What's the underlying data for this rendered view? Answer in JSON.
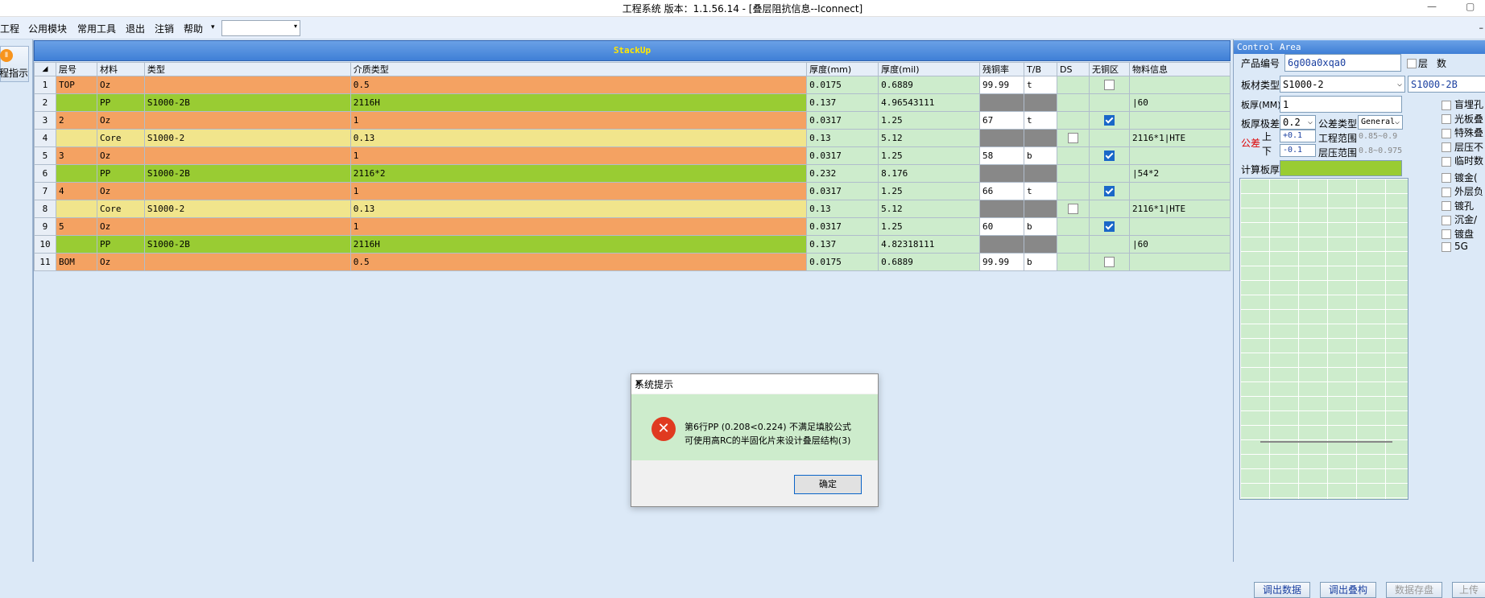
{
  "window": {
    "title": "工程系统   版本：1.1.56.14 - [叠层阻抗信息--Iconnect]",
    "min": "—",
    "restore": "▢"
  },
  "menu": {
    "items": [
      "工程",
      "公用模块",
      "常用工具",
      "退出",
      "注销",
      "帮助"
    ],
    "dropdown_arrow": "▾",
    "combo_value": "",
    "right_mark": "–"
  },
  "left": {
    "button_label": "程指示"
  },
  "stackup": {
    "title": "StackUp",
    "columns": [
      "",
      "层号",
      "材料",
      "类型",
      "介质类型",
      "厚度(mm)",
      "厚度(mil)",
      "残铜率",
      "T/B",
      "DS",
      "无铜区",
      "物料信息"
    ],
    "rows": [
      {
        "idx": "1",
        "kind": "oz",
        "layer": "TOP",
        "material": "Oz",
        "type": "",
        "dielectric": "0.5",
        "mm": "0.0175",
        "mil": "0.6889",
        "residual": "99.99",
        "tb": "t",
        "ds": "",
        "nocu": "unchecked",
        "info": ""
      },
      {
        "idx": "2",
        "kind": "pp",
        "layer": "",
        "material": "PP",
        "type": "S1000-2B",
        "dielectric": "2116H",
        "mm": "0.137",
        "mil": "4.96543111",
        "residual": "gray",
        "tb": "gray",
        "ds": "",
        "nocu": "",
        "info": "|60"
      },
      {
        "idx": "3",
        "kind": "oz",
        "layer": "2",
        "material": "Oz",
        "type": "",
        "dielectric": "1",
        "mm": "0.0317",
        "mil": "1.25",
        "residual": "67",
        "tb": "t",
        "ds": "",
        "nocu": "checked",
        "info": ""
      },
      {
        "idx": "4",
        "kind": "core",
        "layer": "",
        "material": "Core",
        "type": "S1000-2",
        "dielectric": "0.13",
        "mm": "0.13",
        "mil": "5.12",
        "residual": "gray",
        "tb": "gray",
        "ds": "unchecked",
        "nocu": "",
        "info": "2116*1|HTE"
      },
      {
        "idx": "5",
        "kind": "oz",
        "layer": "3",
        "material": "Oz",
        "type": "",
        "dielectric": "1",
        "mm": "0.0317",
        "mil": "1.25",
        "residual": "58",
        "tb": "b",
        "ds": "",
        "nocu": "checked",
        "info": ""
      },
      {
        "idx": "6",
        "kind": "pp",
        "layer": "",
        "material": "PP",
        "type": "S1000-2B",
        "dielectric": "2116*2",
        "mm": "0.232",
        "mil": "8.176",
        "residual": "gray",
        "tb": "gray",
        "ds": "",
        "nocu": "",
        "info": "|54*2"
      },
      {
        "idx": "7",
        "kind": "oz",
        "layer": "4",
        "material": "Oz",
        "type": "",
        "dielectric": "1",
        "mm": "0.0317",
        "mil": "1.25",
        "residual": "66",
        "tb": "t",
        "ds": "",
        "nocu": "checked",
        "info": ""
      },
      {
        "idx": "8",
        "kind": "core",
        "layer": "",
        "material": "Core",
        "type": "S1000-2",
        "dielectric": "0.13",
        "mm": "0.13",
        "mil": "5.12",
        "residual": "gray",
        "tb": "gray",
        "ds": "unchecked",
        "nocu": "",
        "info": "2116*1|HTE"
      },
      {
        "idx": "9",
        "kind": "oz",
        "layer": "5",
        "material": "Oz",
        "type": "",
        "dielectric": "1",
        "mm": "0.0317",
        "mil": "1.25",
        "residual": "60",
        "tb": "b",
        "ds": "",
        "nocu": "checked",
        "info": ""
      },
      {
        "idx": "10",
        "kind": "pp",
        "layer": "",
        "material": "PP",
        "type": "S1000-2B",
        "dielectric": "2116H",
        "mm": "0.137",
        "mil": "4.82318111",
        "residual": "gray",
        "tb": "gray",
        "ds": "",
        "nocu": "",
        "info": "|60"
      },
      {
        "idx": "11",
        "kind": "oz",
        "layer": "BOM",
        "material": "Oz",
        "type": "",
        "dielectric": "0.5",
        "mm": "0.0175",
        "mil": "0.6889",
        "residual": "99.99",
        "tb": "b",
        "ds": "",
        "nocu": "unchecked",
        "info": ""
      }
    ]
  },
  "dialog": {
    "title": "系统提示",
    "close": "✕",
    "icon": "✕",
    "message_line1": "第6行PP (0.208<0.224) 不满足填胶公式",
    "message_line2": "可使用高RC的半固化片来设计叠层结构(3)",
    "ok_label": "确定"
  },
  "control": {
    "title": "Control Area",
    "product_no_label": "产品编号",
    "product_no": "6g00a0xqa0",
    "layer_check_label": "层",
    "layer_count_label": "数",
    "board_type_label": "板材类型",
    "board_type": "S1000-2",
    "board_type_side": "S1000-2B",
    "thickness_label": "板厚(MM)",
    "thickness": "1",
    "thk_tol_label": "板厚极差",
    "thk_tol": "0.2",
    "tol_type_label": "公差类型",
    "tol_type": "General",
    "tol_label": "公差",
    "upper_label": "上",
    "lower_label": "下",
    "upper_value": "+0.1",
    "lower_value": "-0.1",
    "eng_range_label": "工程范围",
    "eng_range": "0.85~0.9",
    "press_range_label": "层压范围",
    "press_range": "0.8~0.975",
    "calc_label": "计算板厚",
    "side_options": [
      "盲埋孔",
      "光板叠",
      "特殊叠",
      "层压不",
      "临时数",
      "镀金(",
      "外层负",
      "镀孔",
      "沉金/",
      "镀盘",
      "5G"
    ],
    "buttons": [
      "调出数据",
      "调出叠构",
      "数据存盘",
      "上传"
    ]
  }
}
